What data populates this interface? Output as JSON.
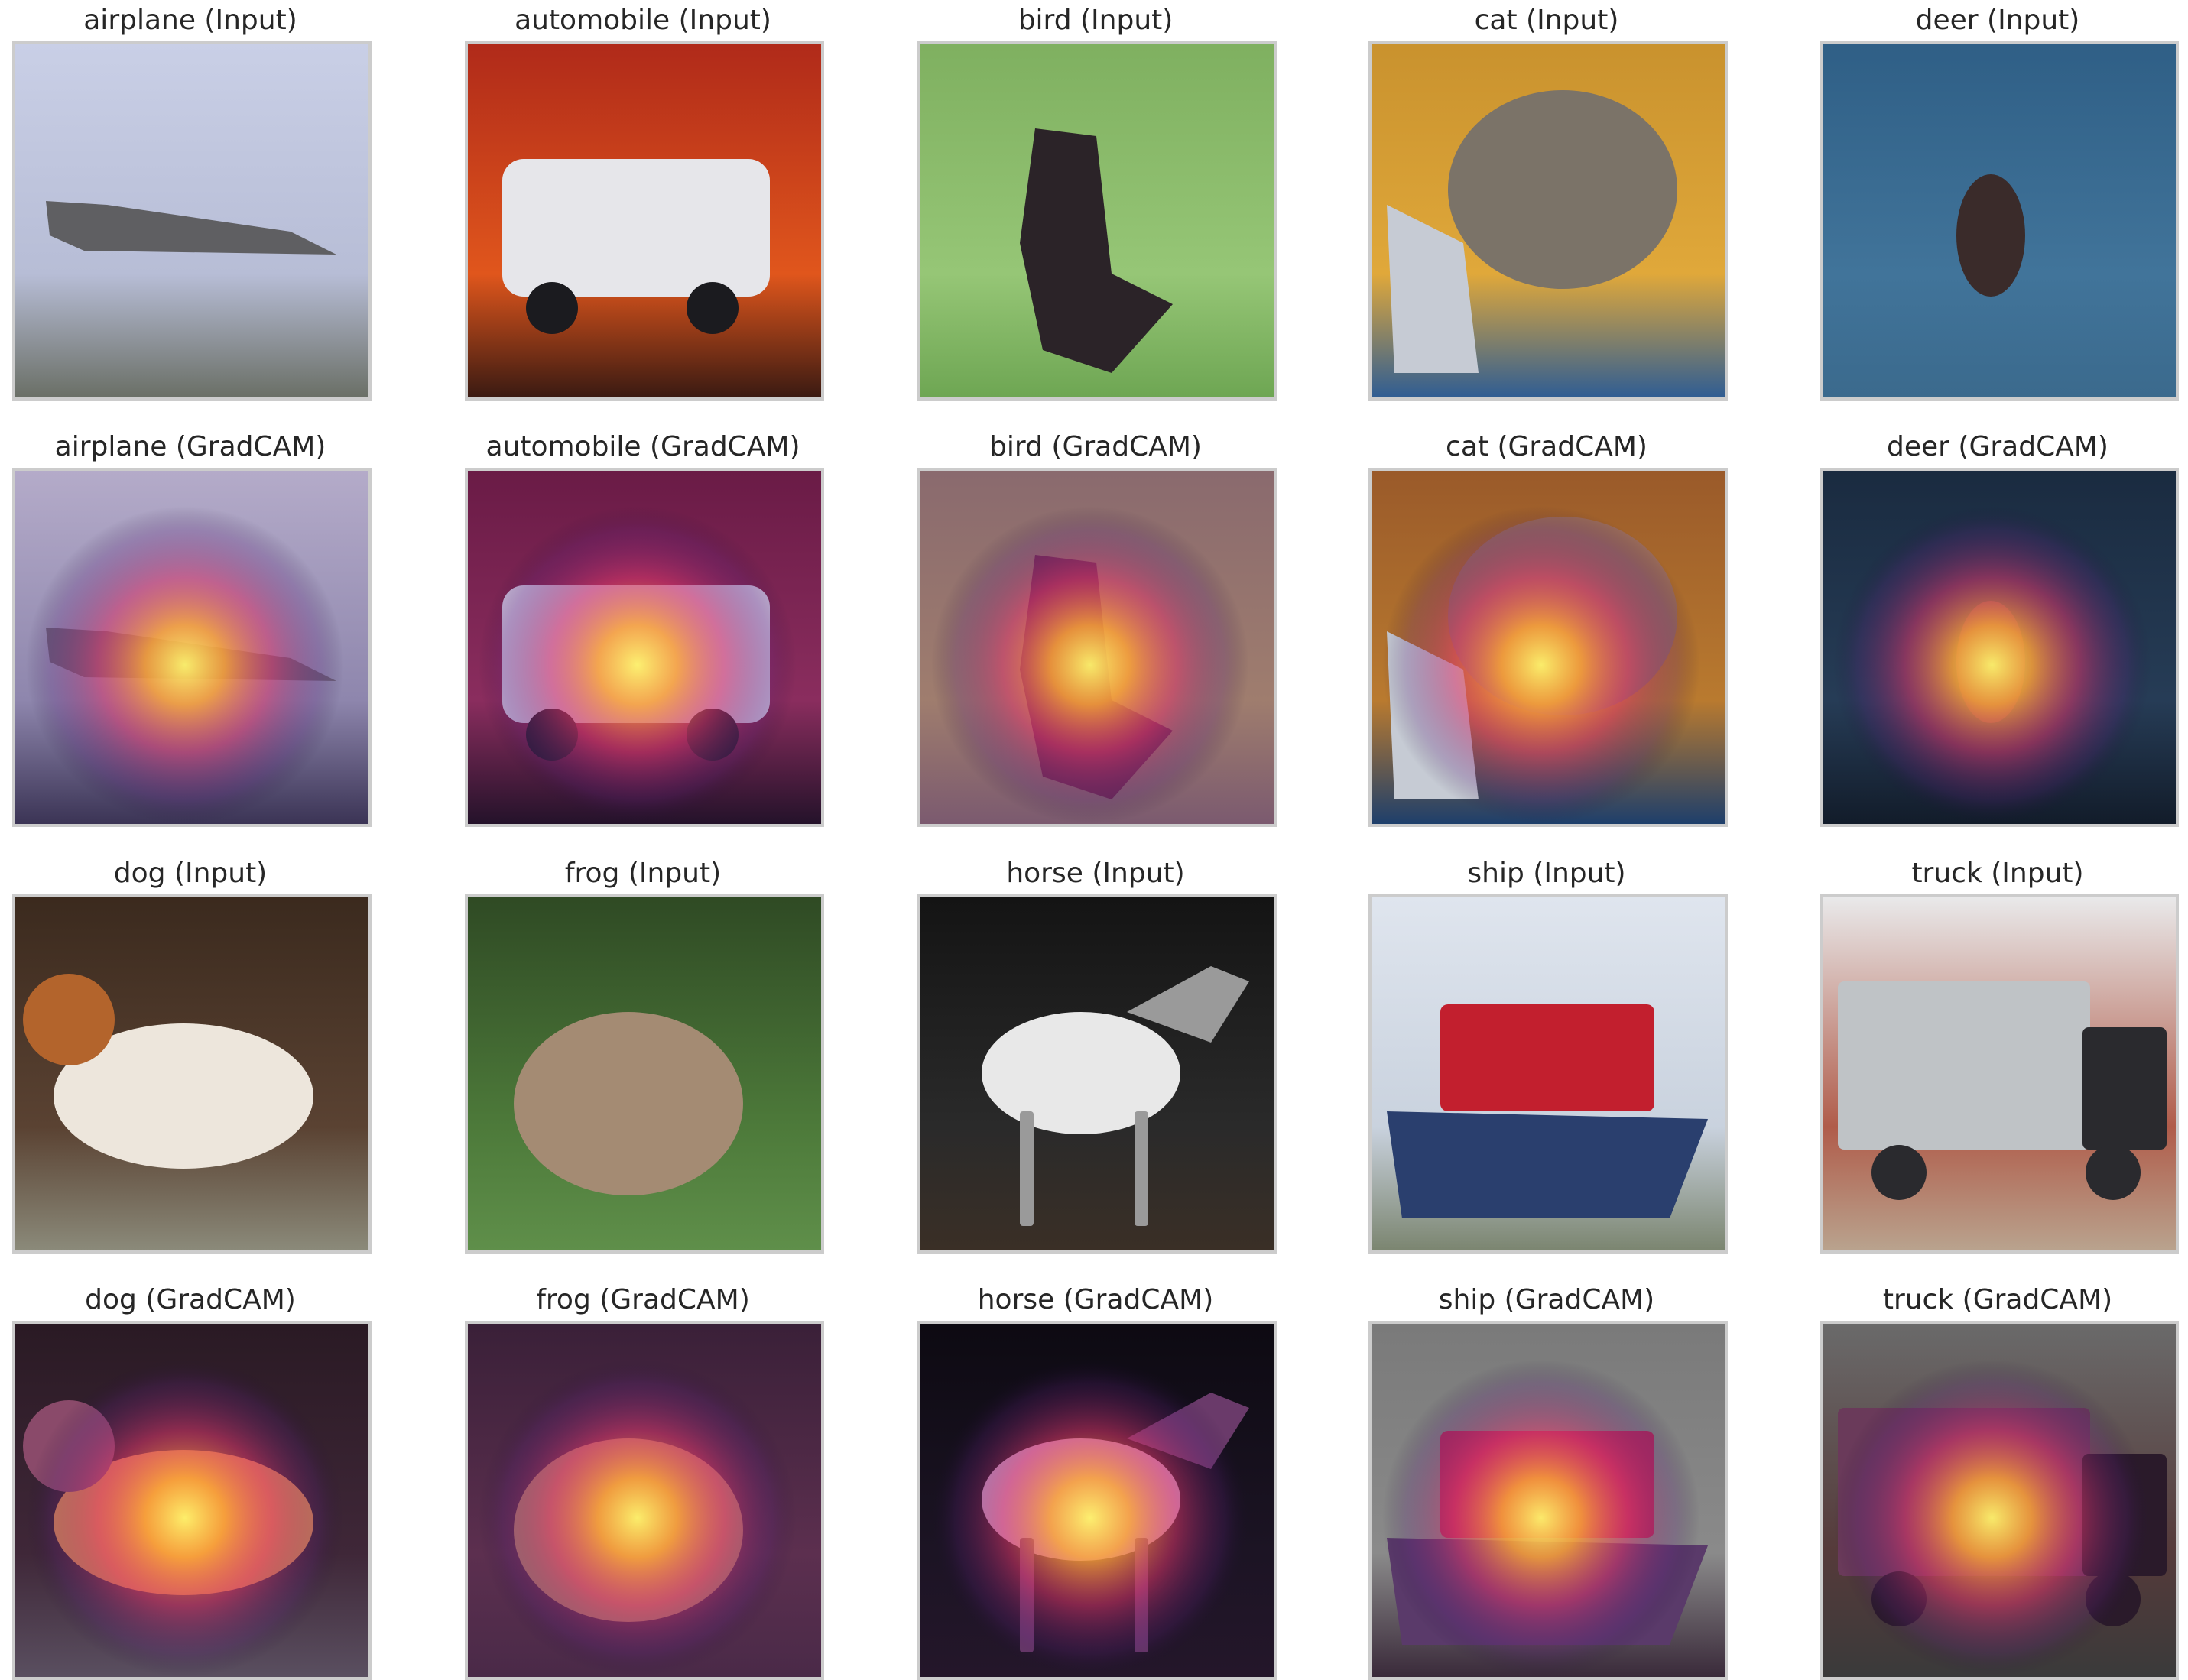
{
  "panels": [
    {
      "title": "airplane (Input)",
      "subject": "airplane",
      "kind": "input",
      "palette": {
        "bg": "#c9cfe6",
        "bg2": "#b7bdd6",
        "ground": "#6a6f66",
        "subject": "#5f5f62",
        "accent": "#c23545"
      }
    },
    {
      "title": "automobile (Input)",
      "subject": "automobile",
      "kind": "input",
      "palette": {
        "bg": "#b02a1a",
        "bg2": "#e0561c",
        "ground": "#3a1a12",
        "subject": "#e6e6ea",
        "accent": "#1b1b1f"
      }
    },
    {
      "title": "bird (Input)",
      "subject": "bird",
      "kind": "input",
      "palette": {
        "bg": "#7fb060",
        "bg2": "#96c676",
        "ground": "#6ea653",
        "subject": "#2b2328",
        "accent": "#9b2f3a"
      }
    },
    {
      "title": "cat (Input)",
      "subject": "cat",
      "kind": "input",
      "palette": {
        "bg": "#c9922e",
        "bg2": "#e0a83a",
        "ground": "#2f5d93",
        "subject": "#7b7368",
        "accent": "#c6cbd4"
      }
    },
    {
      "title": "deer (Input)",
      "subject": "deer",
      "kind": "input",
      "palette": {
        "bg": "#2f5f86",
        "bg2": "#41749a",
        "ground": "#3b6a8d",
        "subject": "#3a2b2a",
        "accent": "#5b86a9"
      }
    },
    {
      "title": "airplane (GradCAM)",
      "subject": "airplane",
      "kind": "gradcam",
      "palette": {
        "bg": "#b4abc9",
        "bg2": "#8e86ad",
        "ground": "#3b3455",
        "subject": "#6d5f7a",
        "accent": "#c23545"
      }
    },
    {
      "title": "automobile (GradCAM)",
      "subject": "automobile",
      "kind": "gradcam",
      "palette": {
        "bg": "#6a1b46",
        "bg2": "#8a2d5e",
        "ground": "#24122a",
        "subject": "#c7b7d8",
        "accent": "#2a1c33"
      }
    },
    {
      "title": "bird (GradCAM)",
      "subject": "bird",
      "kind": "gradcam",
      "palette": {
        "bg": "#8a6a6e",
        "bg2": "#9f7d6e",
        "ground": "#7b5a6f",
        "subject": "#6b2a52",
        "accent": "#b24a5d"
      }
    },
    {
      "title": "cat (GradCAM)",
      "subject": "cat",
      "kind": "gradcam",
      "palette": {
        "bg": "#9a5a2a",
        "bg2": "#b97a2f",
        "ground": "#1e3f6b",
        "subject": "#9a6b5a",
        "accent": "#c6cbd4"
      }
    },
    {
      "title": "deer (GradCAM)",
      "subject": "deer",
      "kind": "gradcam",
      "palette": {
        "bg": "#1a2b40",
        "bg2": "#263c56",
        "ground": "#121c2a",
        "subject": "#6a3a5a",
        "accent": "#3b5f86"
      }
    },
    {
      "title": "dog (Input)",
      "subject": "dog",
      "kind": "input",
      "palette": {
        "bg": "#3b2a1e",
        "bg2": "#5a4232",
        "ground": "#8b8a7a",
        "subject": "#ede6dc",
        "accent": "#b3642c"
      }
    },
    {
      "title": "frog (Input)",
      "subject": "frog",
      "kind": "input",
      "palette": {
        "bg": "#2f4a24",
        "bg2": "#4d7a3a",
        "ground": "#5f8f4a",
        "subject": "#a48b73",
        "accent": "#7fb062"
      }
    },
    {
      "title": "horse (Input)",
      "subject": "horse",
      "kind": "input",
      "palette": {
        "bg": "#141414",
        "bg2": "#2a2a2a",
        "ground": "#3a2f26",
        "subject": "#e8e8e8",
        "accent": "#9a9a9a"
      }
    },
    {
      "title": "ship (Input)",
      "subject": "ship",
      "kind": "input",
      "palette": {
        "bg": "#dfe5ee",
        "bg2": "#c9d2de",
        "ground": "#7b8570",
        "subject": "#2a3f6e",
        "accent": "#c21f2e"
      }
    },
    {
      "title": "truck (Input)",
      "subject": "truck",
      "kind": "input",
      "palette": {
        "bg": "#e9e9ea",
        "bg2": "#b05c4a",
        "ground": "#b9a38e",
        "subject": "#bfc3c6",
        "accent": "#2a2a2e"
      }
    },
    {
      "title": "dog (GradCAM)",
      "subject": "dog",
      "kind": "gradcam",
      "palette": {
        "bg": "#2a1a24",
        "bg2": "#3f2738",
        "ground": "#5a4f60",
        "subject": "#d88a52",
        "accent": "#8a4a6a"
      }
    },
    {
      "title": "frog (GradCAM)",
      "subject": "frog",
      "kind": "gradcam",
      "palette": {
        "bg": "#3a2038",
        "bg2": "#5c2f4f",
        "ground": "#4a2a48",
        "subject": "#b07a6a",
        "accent": "#7a4a6a"
      }
    },
    {
      "title": "horse (GradCAM)",
      "subject": "horse",
      "kind": "gradcam",
      "palette": {
        "bg": "#0d0a12",
        "bg2": "#1c1424",
        "ground": "#24162a",
        "subject": "#c7a2c9",
        "accent": "#6a3a6a"
      }
    },
    {
      "title": "ship (GradCAM)",
      "subject": "ship",
      "kind": "gradcam",
      "palette": {
        "bg": "#7a7a7a",
        "bg2": "#8a8a8a",
        "ground": "#3a2a3a",
        "subject": "#5a3a6a",
        "accent": "#b22a5a"
      }
    },
    {
      "title": "truck (GradCAM)",
      "subject": "truck",
      "kind": "gradcam",
      "palette": {
        "bg": "#6a6a6a",
        "bg2": "#553a3a",
        "ground": "#3a3a3a",
        "subject": "#6a3a5a",
        "accent": "#2a1a2a"
      }
    }
  ]
}
